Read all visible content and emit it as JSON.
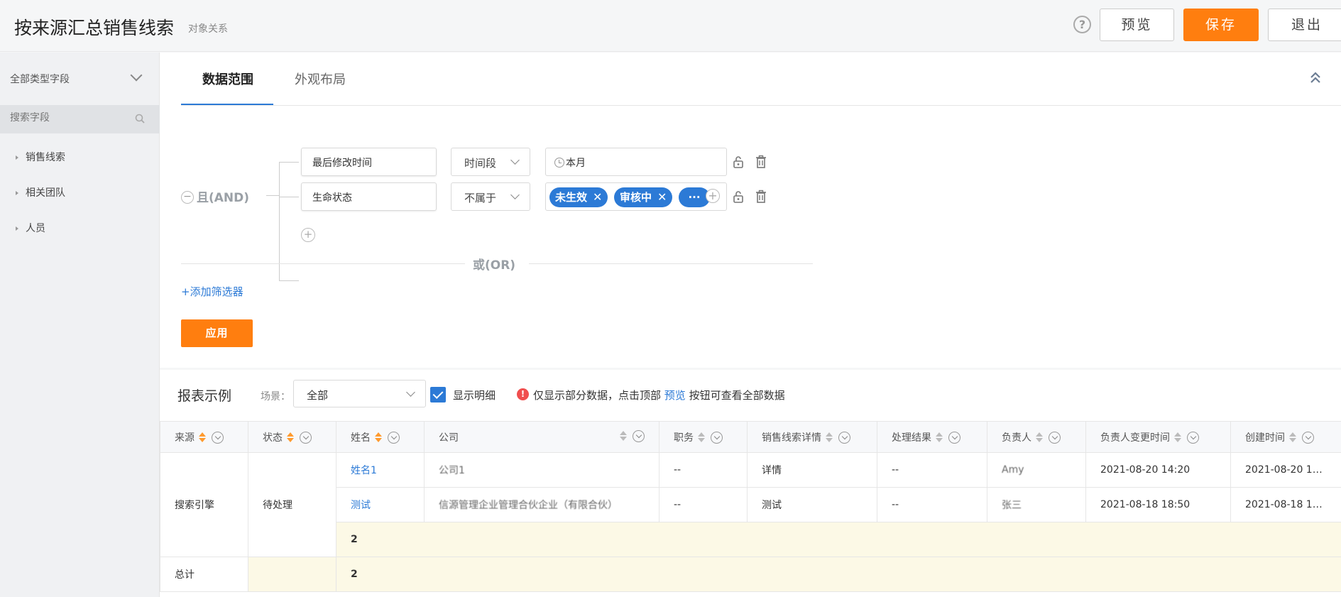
{
  "header": {
    "title": "按来源汇总销售线索",
    "subtitle": "对象关系",
    "help_icon": "?",
    "preview_label": "预览",
    "save_label": "保存",
    "exit_label": "退出"
  },
  "sidebar": {
    "type_filter": "全部类型字段",
    "search_placeholder": "搜索字段",
    "items": [
      {
        "label": "销售线索"
      },
      {
        "label": "相关团队"
      },
      {
        "label": "人员"
      }
    ]
  },
  "tabs": [
    {
      "label": "数据范围",
      "active": true
    },
    {
      "label": "外观布局",
      "active": false
    }
  ],
  "filters": {
    "group_op": "且(AND)",
    "rows": [
      {
        "field": "最后修改时间",
        "operator": "时间段",
        "value": "本月"
      },
      {
        "field": "生命状态",
        "operator": "不属于",
        "tags": [
          "未生效",
          "审核中",
          "···"
        ]
      }
    ],
    "or_label": "或(OR)",
    "add_filter": "+添加筛选器",
    "apply_label": "应用"
  },
  "report": {
    "title": "报表示例",
    "scene_label": "场景：",
    "scene_value": "全部",
    "show_detail_label": "显示明细",
    "show_detail_checked": true,
    "notice_prefix": "仅显示部分数据，点击顶部",
    "notice_link": "预览",
    "notice_suffix": "按钮可查看全部数据",
    "columns": [
      "来源",
      "状态",
      "姓名",
      "公司",
      "职务",
      "销售线索详情",
      "处理结果",
      "负责人",
      "负责人变更时间",
      "创建时间"
    ],
    "group": {
      "source": "搜索引擎",
      "status": "待处理"
    },
    "rows": [
      {
        "name": "姓名1",
        "company": "公司1",
        "title": "--",
        "detail": "详情",
        "result": "--",
        "owner": "Amy",
        "owner_changed": "2021-08-20 14:20",
        "created": "2021-08-20 14..."
      },
      {
        "name": "测试",
        "company": "信源管理企业管理合伙企业（有限合伙）",
        "title": "--",
        "detail": "测试",
        "result": "--",
        "owner": "张三",
        "owner_changed": "2021-08-18 18:50",
        "created": "2021-08-18 18..."
      }
    ],
    "subtotal": "2",
    "total_label": "总计",
    "total": "2"
  },
  "colors": {
    "accent": "#ff7e0f",
    "link": "#2c7ad6"
  }
}
